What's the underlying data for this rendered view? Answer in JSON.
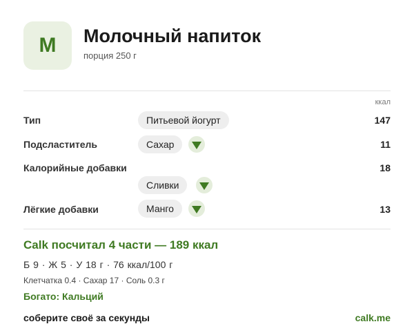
{
  "header": {
    "logo_letter": "M",
    "title": "Молочный напиток",
    "subtitle": "порция 250 г"
  },
  "table": {
    "unit_header": "ккал",
    "rows": [
      {
        "label": "Тип",
        "chip": "Питьевой йогурт",
        "has_dropdown": false,
        "kcal": "147"
      },
      {
        "label": "Подсластитель",
        "chip": "Сахар",
        "has_dropdown": true,
        "kcal": "11"
      },
      {
        "label": "Калорийные добавки",
        "chip": "Сливки",
        "has_dropdown": true,
        "kcal": "18"
      },
      {
        "label": "Лёгкие добавки",
        "chip": "Манго",
        "has_dropdown": true,
        "kcal": "13"
      }
    ]
  },
  "result": {
    "summary": "Calk посчитал 4 части — 189 ккал",
    "macros": "Б 9 · Ж 5 · У 18 г   ·   76 ккал/100 г",
    "micro": "Клетчатка 0.4 · Сахар 17 · Соль 0.3 г",
    "rich_in": "Богато: Кальций"
  },
  "footer": {
    "cta": "соберите своё за секунды",
    "site": "calk.me"
  },
  "colors": {
    "accent": "#3f7a22",
    "logo_bg": "#eaf1e2",
    "chip_bg": "#eeeeee",
    "arrow_bg": "#e4eddb"
  },
  "icons": {
    "dropdown": "triangle-down-icon"
  }
}
